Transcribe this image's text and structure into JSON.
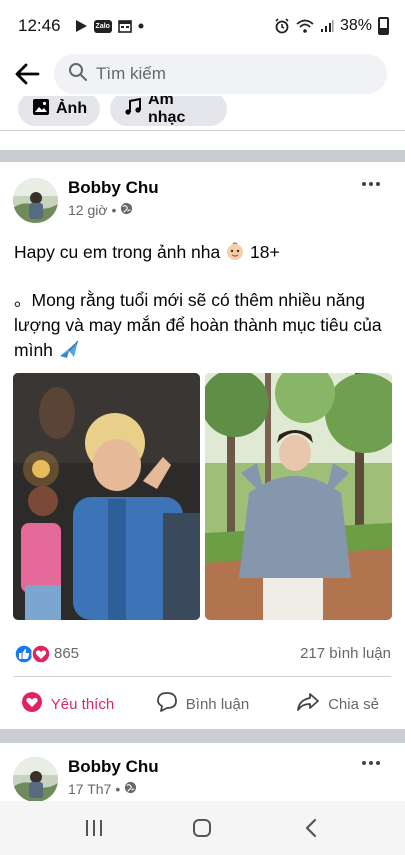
{
  "status_bar": {
    "time": "12:46",
    "zalo_label": "Zalo",
    "battery": "38%"
  },
  "search": {
    "placeholder": "Tìm kiếm"
  },
  "filters": [
    {
      "label": "Ảnh",
      "icon": "photo-icon"
    },
    {
      "label": "Âm nhạc",
      "icon": "music-note-icon"
    }
  ],
  "posts": [
    {
      "author": "Bobby Chu",
      "time": "12 giờ",
      "privacy_icon": "globe-icon",
      "text_line1": "Hapy cu em trong ảnh nha",
      "text_line1_suffix": "18+",
      "text_line2": "。Mong rằng tuổi mới sẽ có thêm nhiều năng lượng và may mắn để hoàn thành mục tiêu của mình",
      "reaction_count": "865",
      "comment_count": "217 bình luận",
      "actions": {
        "like": "Yêu thích",
        "comment": "Bình luận",
        "share": "Chia sẻ"
      }
    },
    {
      "author": "Bobby Chu",
      "time": "17 Th7",
      "privacy_icon": "globe-icon"
    }
  ],
  "colors": {
    "love_red": "#e0245e",
    "like_blue": "#1877f2",
    "secondary_text": "#65676b",
    "chip_bg": "#e4e6eb"
  }
}
